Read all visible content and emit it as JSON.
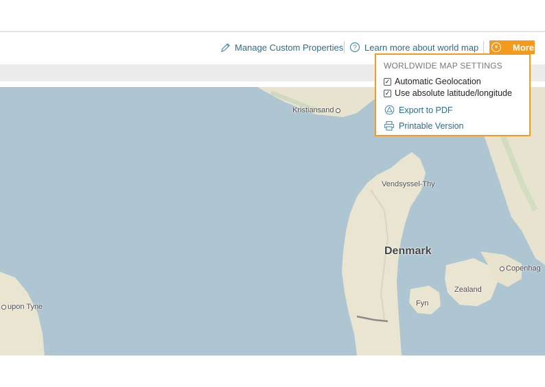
{
  "toolbar": {
    "manage_label": "Manage Custom Properties",
    "learn_label": "Learn more about world map",
    "more_label": "More",
    "icons": {
      "manage": "pencil-icon",
      "learn": "help-circle-icon",
      "more": "chevron-down-icon"
    }
  },
  "dropdown": {
    "title": "WORLDWIDE MAP SETTINGS",
    "options": [
      {
        "label": "Automatic Geolocation",
        "checked": true
      },
      {
        "label": "Use absolute latitude/longitude",
        "checked": true
      }
    ],
    "actions": [
      {
        "label": "Export to PDF",
        "icon": "pdf-icon"
      },
      {
        "label": "Printable Version",
        "icon": "printer-icon"
      }
    ]
  },
  "map": {
    "labels": {
      "kristiansand": "Kristiansand",
      "vendsyssel": "Vendsyssel-Thy",
      "denmark": "Denmark",
      "copenhagen": "Copenhag",
      "zealand": "Zealand",
      "fyn": "Fyn",
      "tyne": "upon Tyne"
    }
  },
  "colors": {
    "accent": "#f39a1f",
    "link": "#2d6d8b",
    "sea": "#adc6d2",
    "land": "#eae6d3"
  }
}
